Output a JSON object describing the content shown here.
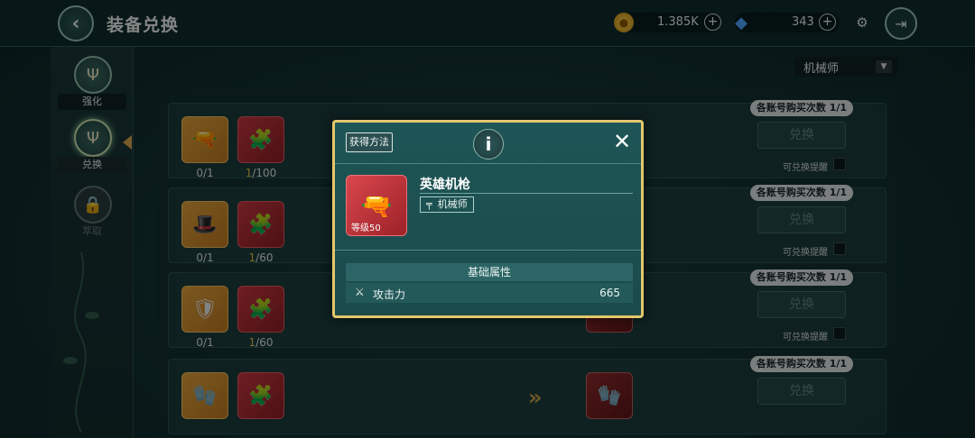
{
  "header": {
    "title": "装备兑换",
    "coins": "1.385K",
    "gems": "343"
  },
  "sidebar": {
    "items": [
      {
        "label": "强化",
        "icon": "trident-icon"
      },
      {
        "label": "兑换",
        "icon": "trident-icon"
      },
      {
        "label": "萃取",
        "icon": "lock-icon"
      }
    ]
  },
  "class_select": {
    "value": "机械师"
  },
  "rows": [
    {
      "mat1": "0/1",
      "mat2": "1/100",
      "limit": "各账号购买次数 1/1",
      "btn": "兑换",
      "remind": "可兑换提醒"
    },
    {
      "mat1": "0/1",
      "mat2": "1/60",
      "limit": "各账号购买次数 1/1",
      "btn": "兑换",
      "remind": "可兑换提醒"
    },
    {
      "mat1": "0/1",
      "mat2": "1/60",
      "limit": "各账号购买次数 1/1",
      "btn": "兑换",
      "remind": "可兑换提醒"
    },
    {
      "mat1": "",
      "mat2": "",
      "limit": "各账号购买次数 1/1",
      "btn": "兑换",
      "remind": ""
    }
  ],
  "popup": {
    "method_btn": "获得方法",
    "info": "i",
    "close": "✕",
    "item_name": "英雄机枪",
    "class_label": "机械师",
    "level": "等级50",
    "stat_header": "基础属性",
    "stat_name": "攻击力",
    "stat_value": "665"
  }
}
